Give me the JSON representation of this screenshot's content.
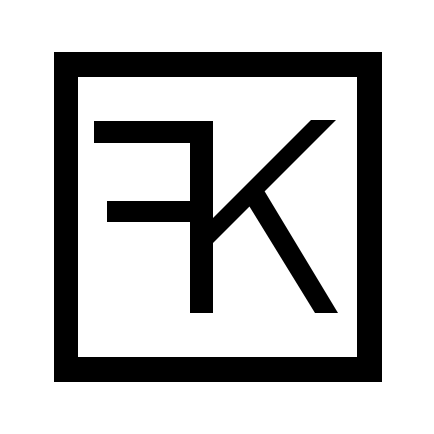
{
  "logo": {
    "monogram_text": "FK",
    "colors": {
      "background": "#ffffff",
      "ink": "#000000"
    }
  }
}
